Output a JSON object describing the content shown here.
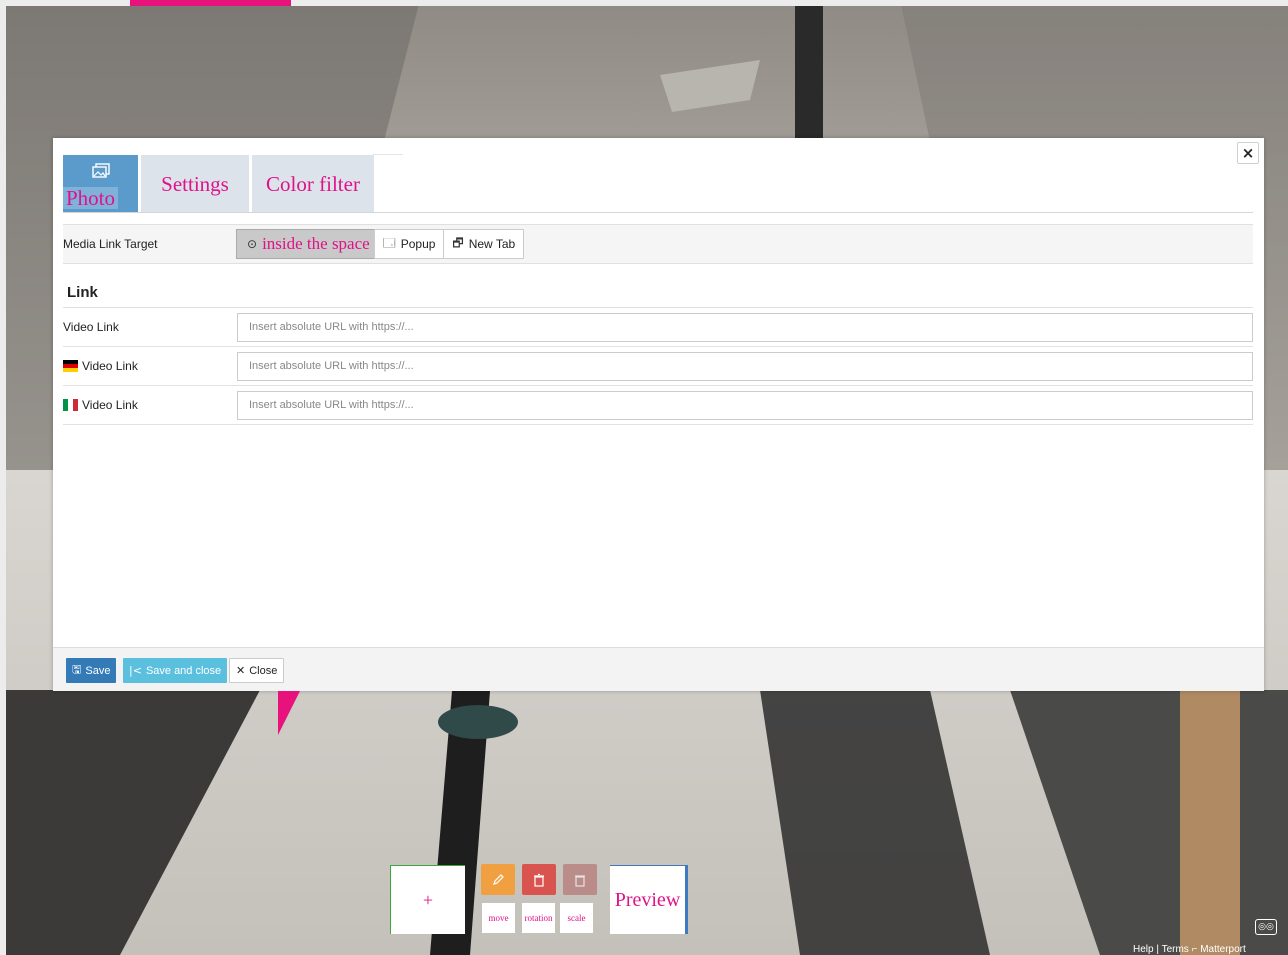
{
  "tabs": {
    "photo": "Photo",
    "settings": "Settings",
    "color_filter": "Color filter"
  },
  "media_link_target": {
    "label": "Media Link Target",
    "options": [
      "inside the space",
      "Popup",
      "New Tab"
    ],
    "selected": "inside the space"
  },
  "link_section": {
    "title": "Link",
    "rows": [
      {
        "label": "Video Link",
        "flag": "none",
        "placeholder": "Insert absolute URL with https://..."
      },
      {
        "label": "Video Link",
        "flag": "de",
        "placeholder": "Insert absolute URL with https://..."
      },
      {
        "label": "Video Link",
        "flag": "it",
        "placeholder": "Insert absolute URL with https://..."
      }
    ]
  },
  "footer": {
    "save": "Save",
    "save_and_close": "Save and close",
    "close": "Close"
  },
  "toolbar": {
    "add": "+",
    "move": "move",
    "rotation": "rotation",
    "scale": "scale",
    "preview": "Preview"
  },
  "matterport_footer": {
    "help": "Help",
    "separator": "|",
    "terms": "Terms",
    "brand": "Matterport"
  },
  "colors": {
    "accent_pink": "#e0128a",
    "primary_blue": "#337ab7",
    "info_blue": "#5bc0de",
    "edit_orange": "#f0a040",
    "delete_red": "#d9534f"
  }
}
